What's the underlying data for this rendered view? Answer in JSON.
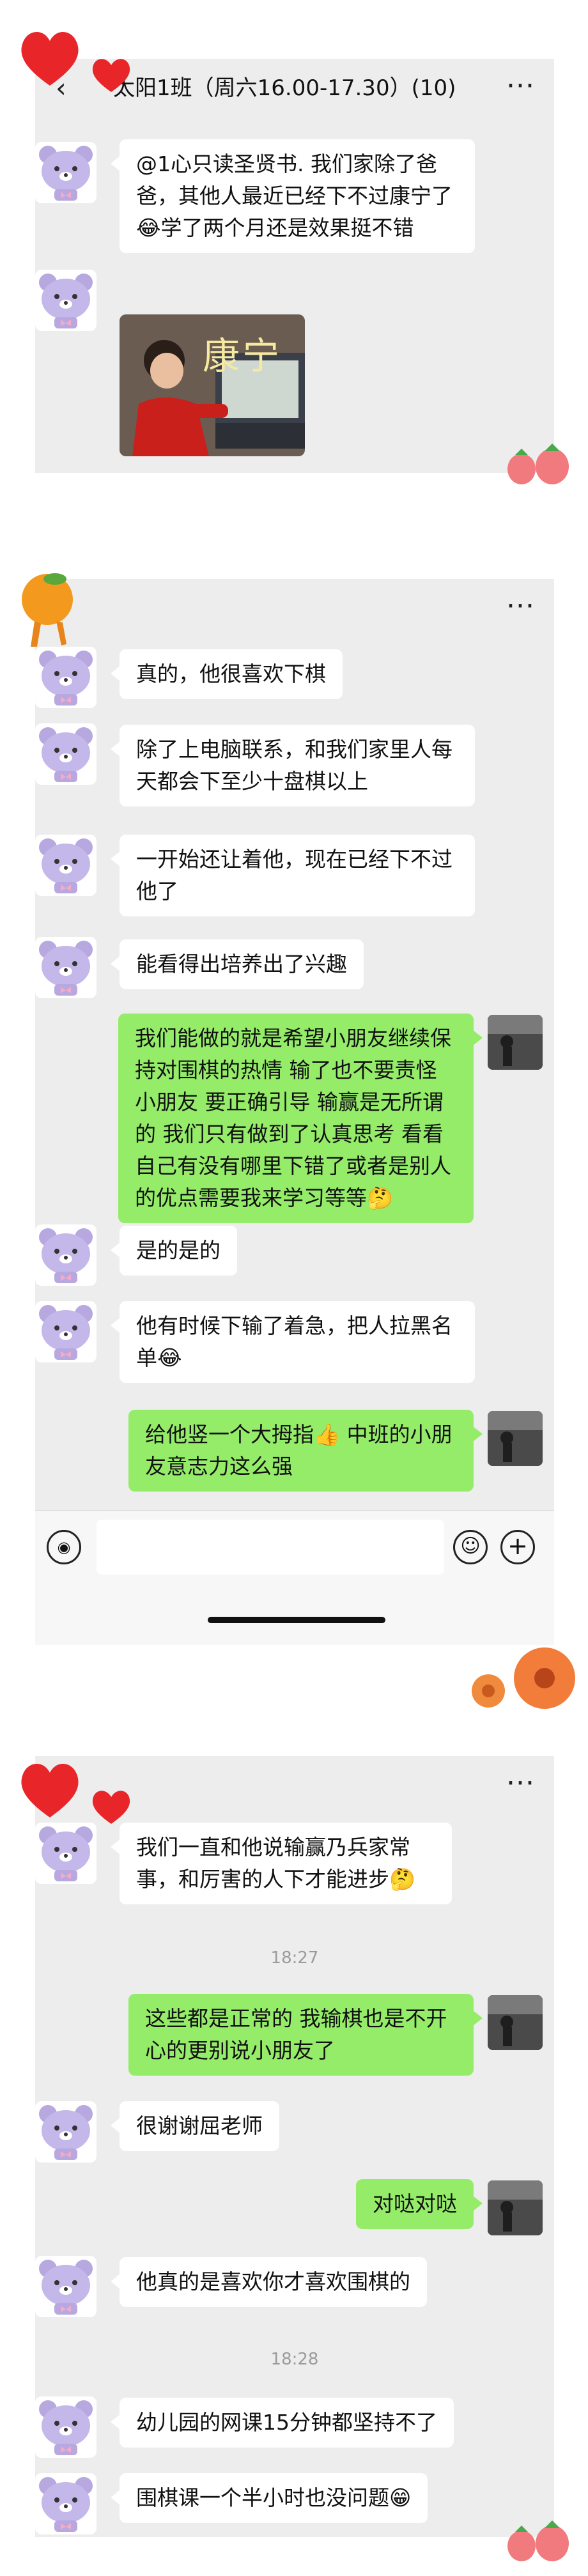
{
  "colors": {
    "panel_bg": "#ededed",
    "incoming_bubble": "#ffffff",
    "outgoing_bubble": "#95ec69",
    "timestamp": "#9b9b9b"
  },
  "screen1": {
    "title": "太阳1班（周六16.00-17.30）(10)",
    "back_icon": "chevron-left-icon",
    "more_icon": "more-icon",
    "messages": [
      {
        "text": "@1心只读圣贤书. 我们家除了爸爸，其他人最近已经下不过康宁了😂学了两个月还是效果挺不错"
      }
    ],
    "photo_caption": "康宁"
  },
  "screen2": {
    "more_icon": "more-icon",
    "messages": [
      {
        "text": "真的，他很喜欢下棋"
      },
      {
        "text": "除了上电脑联系，和我们家里人每天都会下至少十盘棋以上"
      },
      {
        "text": "一开始还让着他，现在已经下不过他了"
      },
      {
        "text": "能看得出培养出了兴趣"
      },
      {
        "text": "我们能做的就是希望小朋友继续保持对围棋的热情  输了也不要责怪小朋友 要正确引导 输赢是无所谓的 我们只有做到了认真思考 看看自己有没有哪里下错了或者是别人的优点需要我来学习等等🤔"
      },
      {
        "text": "是的是的"
      },
      {
        "text": "他有时候下输了着急，把人拉黑名单😂"
      },
      {
        "text": "给他竖一个大拇指👍 中班的小朋友意志力这么强"
      }
    ],
    "input": {
      "voice_icon": "voice-icon",
      "emoji_icon": "emoji-icon",
      "plus_icon": "plus-icon"
    }
  },
  "screen3": {
    "back_icon": "chevron-left-icon",
    "more_icon": "more-icon",
    "messages": [
      {
        "text": "我们一直和他说输赢乃兵家常事，和厉害的人下才能进步🤔"
      },
      {
        "text": "这些都是正常的 我输棋也是不开心的更别说小朋友了"
      },
      {
        "text": "很谢谢屈老师"
      },
      {
        "text": "对哒对哒"
      },
      {
        "text": "他真的是喜欢你才喜欢围棋的"
      },
      {
        "text": "幼儿园的网课15分钟都坚持不了"
      },
      {
        "text": "围棋课一个半小时也没问题😁"
      }
    ],
    "timestamps": [
      "18:27",
      "18:28"
    ]
  }
}
